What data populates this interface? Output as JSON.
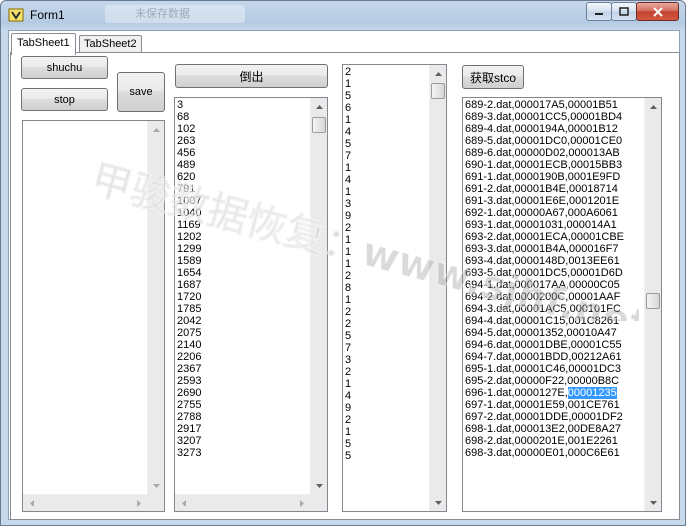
{
  "window": {
    "title": "Form1",
    "title_ghost": "未保存数据"
  },
  "tabs": [
    "TabSheet1",
    "TabSheet2"
  ],
  "buttons": {
    "shuchu": "shuchu",
    "stop": "stop",
    "save": "save",
    "daochu": "倒出",
    "huoqu": "获取stco"
  },
  "list_numbers": [
    "3",
    "68",
    "102",
    "263",
    "456",
    "489",
    "620",
    "791",
    "1007",
    "1040",
    "1169",
    "1202",
    "1299",
    "1589",
    "1654",
    "1687",
    "1720",
    "1785",
    "2042",
    "2075",
    "2140",
    "2206",
    "2367",
    "2593",
    "2690",
    "2755",
    "2788",
    "2917",
    "3207",
    "3273"
  ],
  "list_digits": [
    "2",
    "1",
    "5",
    "6",
    "1",
    "4",
    "5",
    "7",
    "1",
    "4",
    "1",
    "3",
    "9",
    "2",
    "1",
    "1",
    "1",
    "2",
    "8",
    "1",
    "2",
    "2",
    "5",
    "7",
    "3",
    "2",
    "1",
    "4",
    "9",
    "2",
    "1",
    "5",
    "5"
  ],
  "list_stco": {
    "items": [
      "689-2.dat,000017A5,00001B51",
      "689-3.dat,00001CC5,00001BD4",
      "689-4.dat,0000194A,00001B12",
      "689-5.dat,00001DC0,00001CE0",
      "689-6.dat,00000D02,000013AB",
      "690-1.dat,00001ECB,00015BB3",
      "691-1.dat,0000190B,0001E9FD",
      "691-2.dat,00001B4E,00018714",
      "691-3.dat,00001E6E,0001201E",
      "692-1.dat,00000A67,000A6061",
      "693-1.dat,00001031,000014A1",
      "693-2.dat,00001ECA,00001CBE",
      "693-3.dat,00001B4A,000016F7",
      "693-4.dat,0000148D,0013EE61",
      "693-5.dat,00001DC5,00001D6D",
      "694-1.dat,000017AA,00000C05",
      "694-2.dat,0000200C,00001AAF",
      "694-3.dat,00001AC5,000101FC",
      "694-4.dat,00001C15,001C8261",
      "694-5.dat,00001352,00010A47",
      "694-6.dat,00001DBE,00001C55",
      "694-7.dat,00001BDD,00212A61",
      "695-1.dat,00001C46,00001DC3",
      "695-2.dat,00000F22,00000B8C"
    ],
    "selected_item": {
      "prefix": "696-1.dat,0000127E,",
      "highlight": "00001235"
    },
    "items_after": [
      "697-1.dat,00001E59,001CE761",
      "697-2.dat,00001DDE,00001DF2",
      "698-1.dat,000013E2,00DE8A27",
      "698-2.dat,0000201E,001E2261",
      "698-3.dat,00000E01,000C6E61"
    ]
  },
  "watermark": {
    "text": "甲骏数据恢复：www.sjhf.net"
  },
  "colors": {
    "selection": "#3399ff",
    "window_frame": "#c5d7ea"
  }
}
